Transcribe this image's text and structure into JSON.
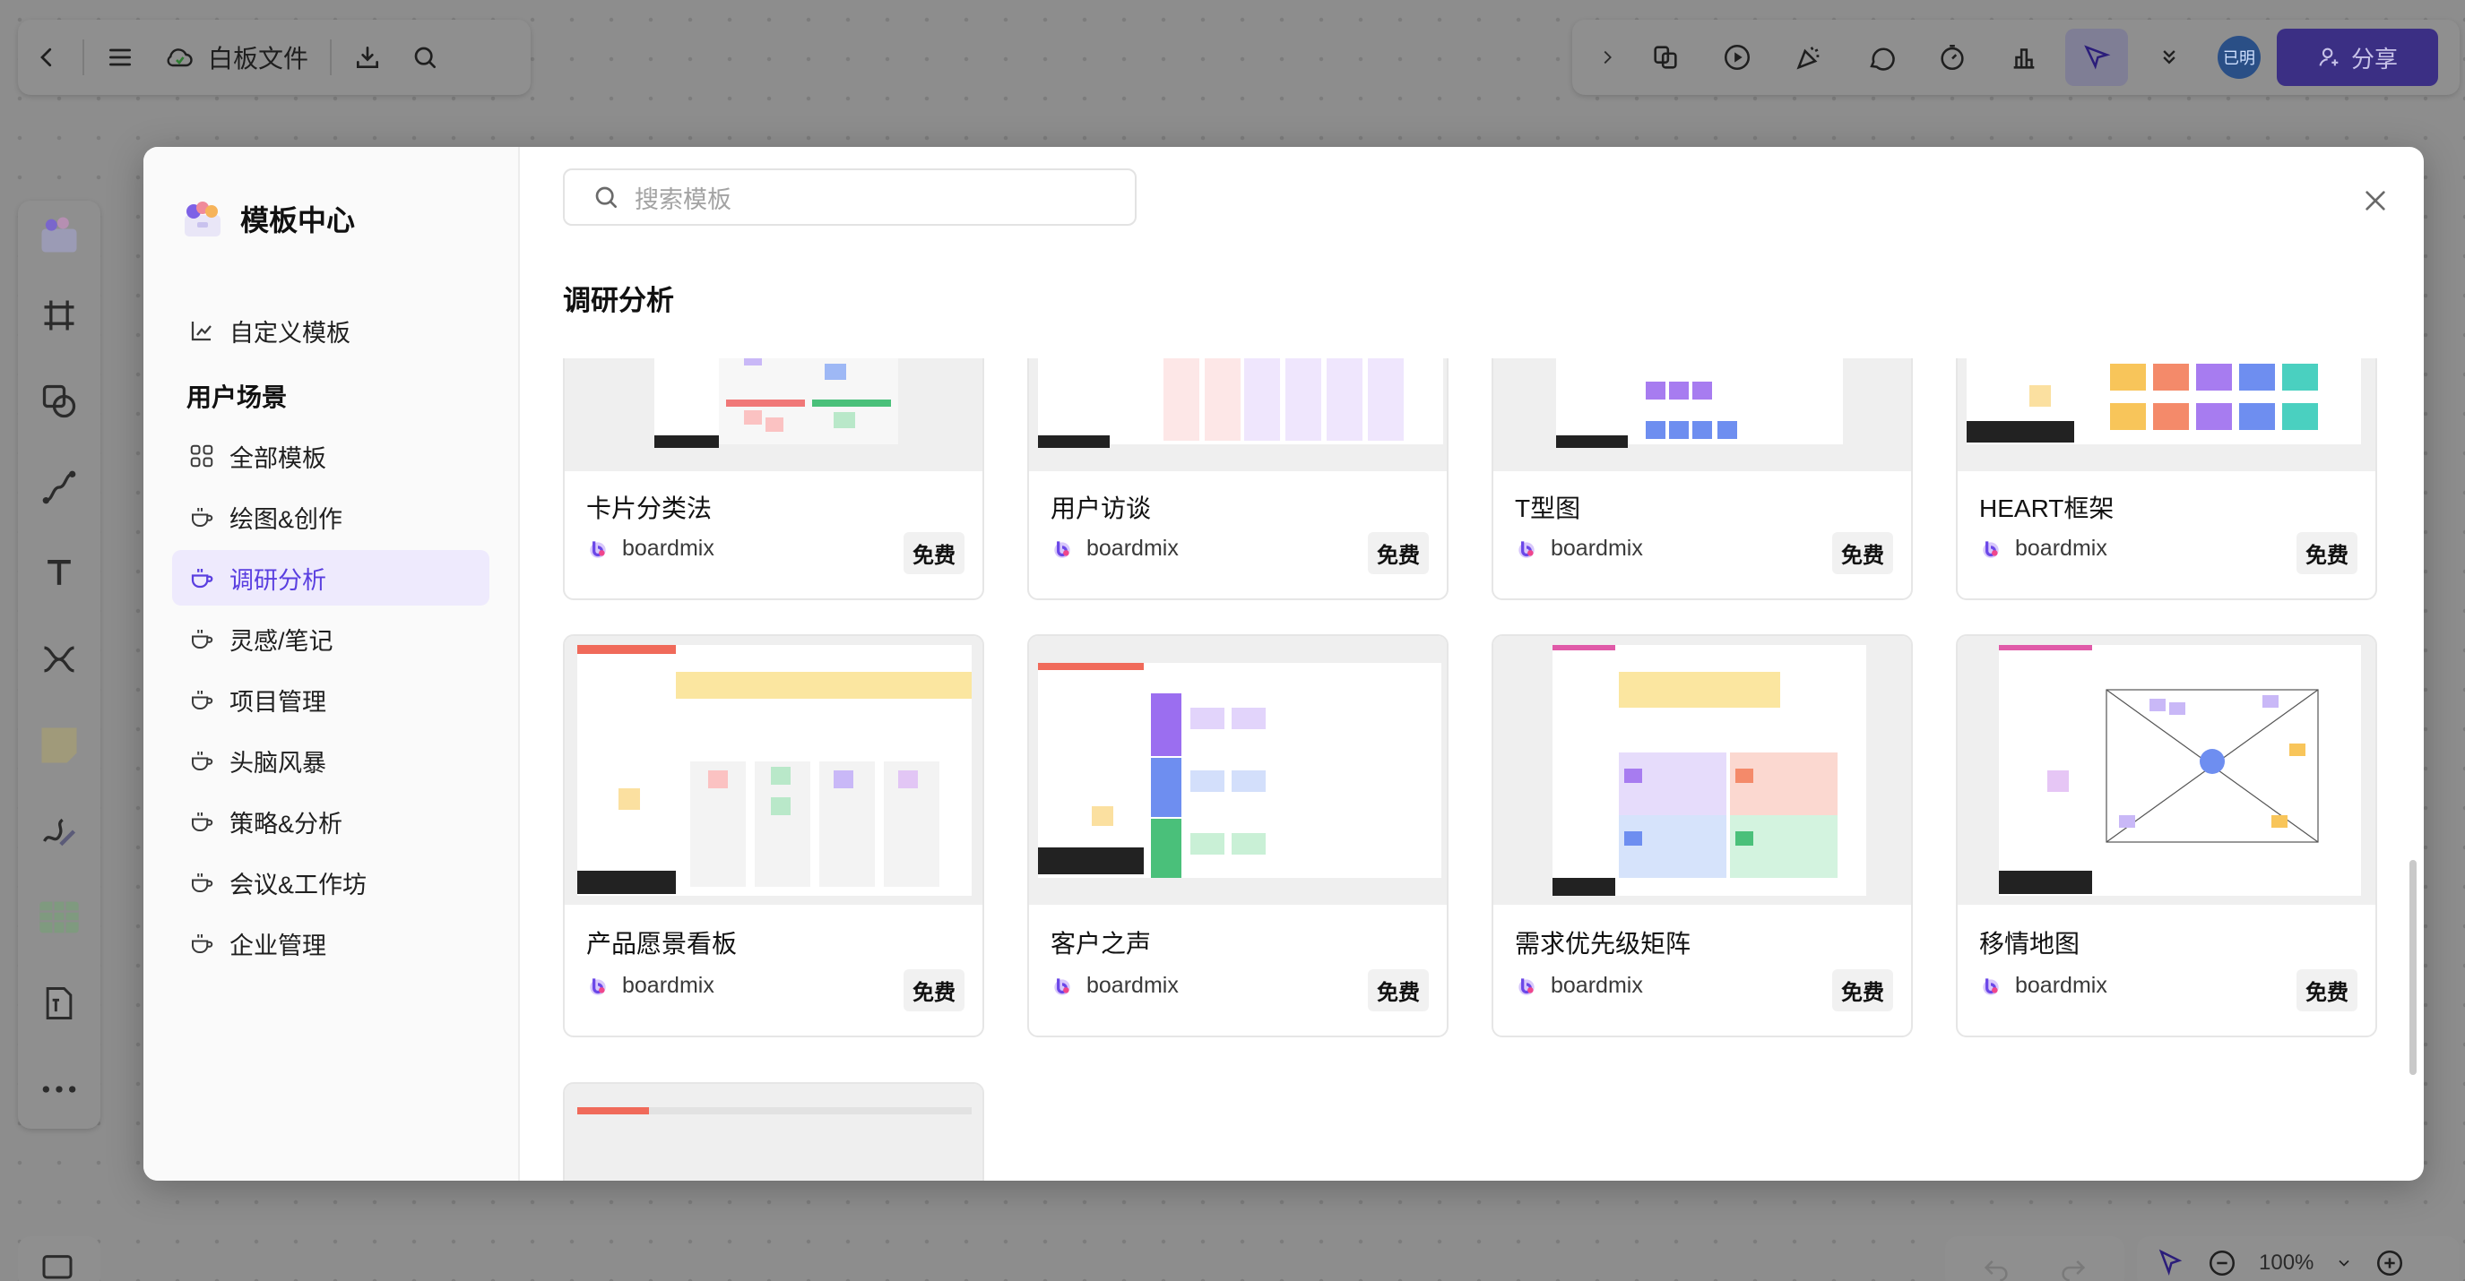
{
  "toolbar": {
    "file_name": "白板文件",
    "avatar_label": "已明",
    "share_label": "分享"
  },
  "bottom": {
    "zoom": "100%"
  },
  "modal": {
    "brand_title": "模板中心",
    "custom_templates": "自定义模板",
    "section_heading": "用户场景",
    "categories": [
      {
        "label": "全部模板"
      },
      {
        "label": "绘图&创作"
      },
      {
        "label": "调研分析"
      },
      {
        "label": "灵感/笔记"
      },
      {
        "label": "项目管理"
      },
      {
        "label": "头脑风暴"
      },
      {
        "label": "策略&分析"
      },
      {
        "label": "会议&工作坊"
      },
      {
        "label": "企业管理"
      }
    ],
    "active_category": "调研分析",
    "search_placeholder": "搜索模板",
    "section_title": "调研分析",
    "templates": [
      {
        "name": "卡片分类法",
        "author": "boardmix",
        "price": "免费"
      },
      {
        "name": "用户访谈",
        "author": "boardmix",
        "price": "免费"
      },
      {
        "name": "T型图",
        "author": "boardmix",
        "price": "免费"
      },
      {
        "name": "HEART框架",
        "author": "boardmix",
        "price": "免费"
      },
      {
        "name": "产品愿景看板",
        "author": "boardmix",
        "price": "免费"
      },
      {
        "name": "客户之声",
        "author": "boardmix",
        "price": "免费"
      },
      {
        "name": "需求优先级矩阵",
        "author": "boardmix",
        "price": "免费"
      },
      {
        "name": "移情地图",
        "author": "boardmix",
        "price": "免费"
      }
    ]
  },
  "colors": {
    "accent": "#5a3fe0",
    "active_bg": "#eeeafd",
    "share_bg": "#3b2f84",
    "overlay_canvas": "#8d8d8d"
  }
}
